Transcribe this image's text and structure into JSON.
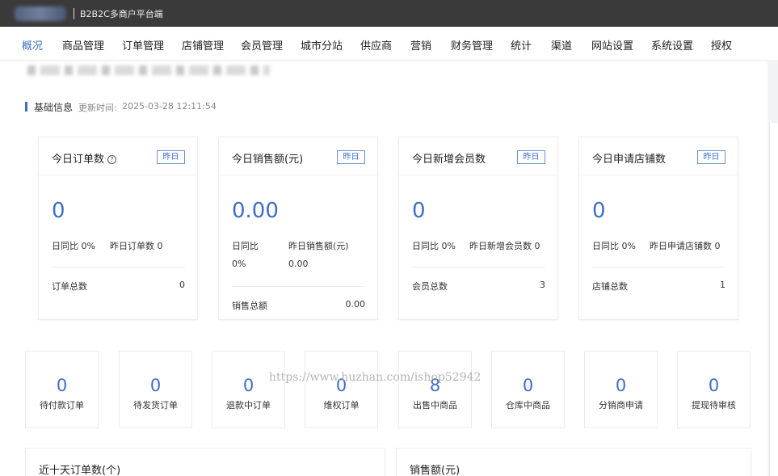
{
  "topbar": {
    "title": "B2B2C多商户平台端"
  },
  "nav": {
    "items": [
      {
        "label": "概况",
        "active": true
      },
      {
        "label": "商品管理"
      },
      {
        "label": "订单管理"
      },
      {
        "label": "店铺管理"
      },
      {
        "label": "会员管理"
      },
      {
        "label": "城市分站"
      },
      {
        "label": "供应商"
      },
      {
        "label": "营销"
      },
      {
        "label": "财务管理"
      },
      {
        "label": "统计"
      },
      {
        "label": "渠道"
      },
      {
        "label": "网站设置"
      },
      {
        "label": "系统设置"
      },
      {
        "label": "授权"
      }
    ]
  },
  "section": {
    "title": "基础信息",
    "updated_label": "更新时间:",
    "updated_time": "2025-03-28 12:11:54"
  },
  "cards": [
    {
      "title": "今日订单数",
      "has_help": true,
      "tag": "昨日",
      "value": "0",
      "compare_label": "日同比",
      "compare_value": "0%",
      "yesterday_label": "昨日订单数",
      "yesterday_value": "0",
      "total_label": "订单总数",
      "total_value": "0"
    },
    {
      "title": "今日销售额(元)",
      "has_help": false,
      "tag": "昨日",
      "value": "0.00",
      "compare_label": "日同比",
      "compare_value": "0%",
      "yesterday_label": "昨日销售额(元)",
      "yesterday_value": "0.00",
      "total_label": "销售总额",
      "total_value": "0.00"
    },
    {
      "title": "今日新增会员数",
      "has_help": false,
      "tag": "昨日",
      "value": "0",
      "compare_label": "日同比",
      "compare_value": "0%",
      "yesterday_label": "昨日新增会员数",
      "yesterday_value": "0",
      "total_label": "会员总数",
      "total_value": "3"
    },
    {
      "title": "今日申请店铺数",
      "has_help": false,
      "tag": "昨日",
      "value": "0",
      "compare_label": "日同比",
      "compare_value": "0%",
      "yesterday_label": "昨日申请店铺数",
      "yesterday_value": "0",
      "total_label": "店铺总数",
      "total_value": "1"
    }
  ],
  "tiles": [
    {
      "value": "0",
      "label": "待付款订单"
    },
    {
      "value": "0",
      "label": "待发货订单"
    },
    {
      "value": "0",
      "label": "退款中订单"
    },
    {
      "value": "0",
      "label": "维权订单"
    },
    {
      "value": "8",
      "label": "出售中商品"
    },
    {
      "value": "0",
      "label": "仓库中商品"
    },
    {
      "value": "0",
      "label": "分销商申请"
    },
    {
      "value": "0",
      "label": "提现待审核"
    }
  ],
  "watermark": "https://www.huzhan.com/ishop52942",
  "panels": [
    {
      "title": "近十天订单数(个)"
    },
    {
      "title": "销售额(元)"
    }
  ],
  "colors": {
    "accent": "#3f6ec6",
    "topbar": "#3a3a3a"
  }
}
